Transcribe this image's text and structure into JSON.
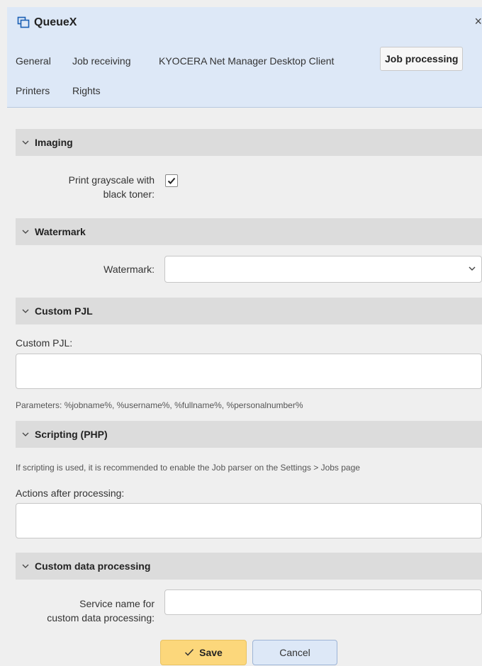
{
  "window": {
    "title": "QueueX",
    "icon": "queue-copy-icon",
    "close_icon": "close-icon",
    "close_glyph": "×"
  },
  "tabs": [
    {
      "label": "General"
    },
    {
      "label": "Job receiving"
    },
    {
      "label": "KYOCERA Net Manager Desktop Client"
    },
    {
      "label": "Job processing",
      "active": true
    },
    {
      "label": "Printers"
    },
    {
      "label": "Rights"
    }
  ],
  "sections": {
    "imaging": {
      "title": "Imaging",
      "grayscale_label_line1": "Print grayscale with",
      "grayscale_label_line2": "black toner:",
      "grayscale_checked": true
    },
    "watermark": {
      "title": "Watermark",
      "field_label": "Watermark:",
      "value": ""
    },
    "custom_pjl": {
      "title": "Custom PJL",
      "field_label": "Custom PJL:",
      "value": "",
      "hint": "Parameters: %jobname%, %username%, %fullname%, %personalnumber%"
    },
    "scripting": {
      "title": "Scripting (PHP)",
      "hint": "If scripting is used, it is recommended to enable the Job parser on the Settings > Jobs page",
      "field_label": "Actions after processing:",
      "value": ""
    },
    "custom_data": {
      "title": "Custom data processing",
      "field_label_line1": "Service name for",
      "field_label_line2": "custom data processing:",
      "value": ""
    }
  },
  "buttons": {
    "save": "Save",
    "cancel": "Cancel"
  },
  "colors": {
    "header_bg": "#dde8f7",
    "save_bg": "#fcd77b",
    "cancel_bg": "#dde8f7",
    "section_bg": "#dcdcdc"
  }
}
